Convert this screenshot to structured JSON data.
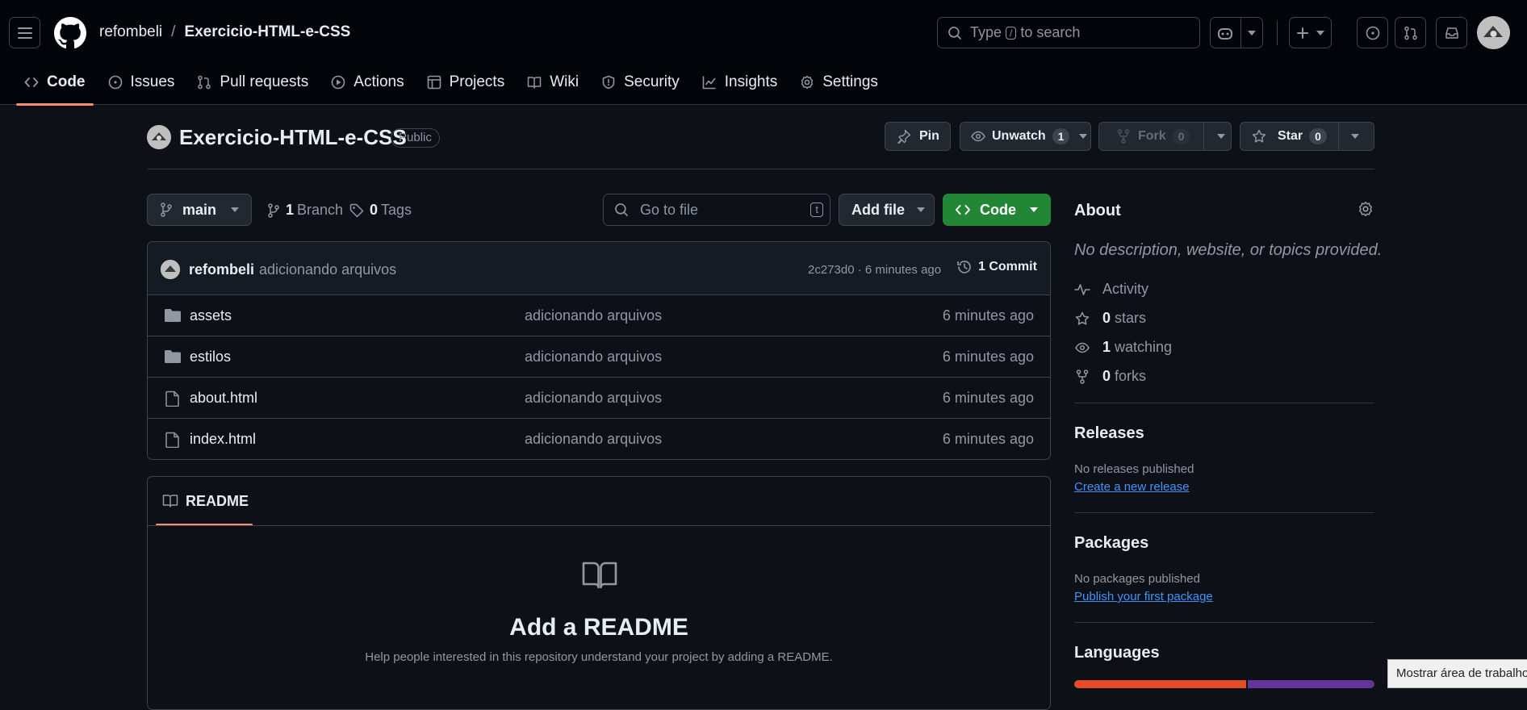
{
  "header": {
    "owner": "refombeli",
    "separator": "/",
    "repo": "Exercicio-HTML-e-CSS",
    "search_pre": "Type",
    "search_key": "/",
    "search_post": "to search"
  },
  "tabs": [
    {
      "label": "Code",
      "icon": "code-icon"
    },
    {
      "label": "Issues",
      "icon": "issue-icon"
    },
    {
      "label": "Pull requests",
      "icon": "pull-request-icon"
    },
    {
      "label": "Actions",
      "icon": "play-icon"
    },
    {
      "label": "Projects",
      "icon": "table-icon"
    },
    {
      "label": "Wiki",
      "icon": "book-icon"
    },
    {
      "label": "Security",
      "icon": "shield-icon"
    },
    {
      "label": "Insights",
      "icon": "graph-icon"
    },
    {
      "label": "Settings",
      "icon": "gear-icon"
    }
  ],
  "repo": {
    "title": "Exercicio-HTML-e-CSS",
    "visibility": "Public",
    "pin_label": "Pin",
    "unwatch_label": "Unwatch",
    "unwatch_count": "1",
    "fork_label": "Fork",
    "fork_count": "0",
    "star_label": "Star",
    "star_count": "0"
  },
  "filenav": {
    "branch": "main",
    "branch_count": "1",
    "branch_label": "Branch",
    "tag_count": "0",
    "tag_label": "Tags",
    "goto_placeholder": "Go to file",
    "goto_key": "t",
    "add_file": "Add file",
    "code": "Code"
  },
  "commit": {
    "user": "refombeli",
    "message": "adicionando arquivos",
    "hash_time": "2c273d0 · 6 minutes ago",
    "count_label": "1 Commit"
  },
  "files": [
    {
      "name": "assets",
      "type": "folder",
      "message": "adicionando arquivos",
      "time": "6 minutes ago"
    },
    {
      "name": "estilos",
      "type": "folder",
      "message": "adicionando arquivos",
      "time": "6 minutes ago"
    },
    {
      "name": "about.html",
      "type": "file",
      "message": "adicionando arquivos",
      "time": "6 minutes ago"
    },
    {
      "name": "index.html",
      "type": "file",
      "message": "adicionando arquivos",
      "time": "6 minutes ago"
    }
  ],
  "readme": {
    "tab": "README",
    "title": "Add a README",
    "subtitle": "Help people interested in this repository understand your project by adding a README."
  },
  "sidebar": {
    "about_title": "About",
    "about_desc": "No description, website, or topics provided.",
    "activity": "Activity",
    "stars_count": "0",
    "stars_label": "stars",
    "watching_count": "1",
    "watching_label": "watching",
    "forks_count": "0",
    "forks_label": "forks",
    "releases_title": "Releases",
    "releases_note": "No releases published",
    "releases_link": "Create a new release",
    "packages_title": "Packages",
    "packages_note": "No packages published",
    "packages_link": "Publish your first package",
    "languages_title": "Languages",
    "languages": [
      {
        "share": 0.575,
        "color": "#e34c26"
      },
      {
        "share": 0.425,
        "color": "#663399"
      }
    ]
  },
  "tooltip": "Mostrar área de trabalho",
  "colors": {
    "background": "#0d1117",
    "header": "#010409",
    "accent_tab": "#fd8c73",
    "code_button": "#238636",
    "link": "#4493f8"
  }
}
